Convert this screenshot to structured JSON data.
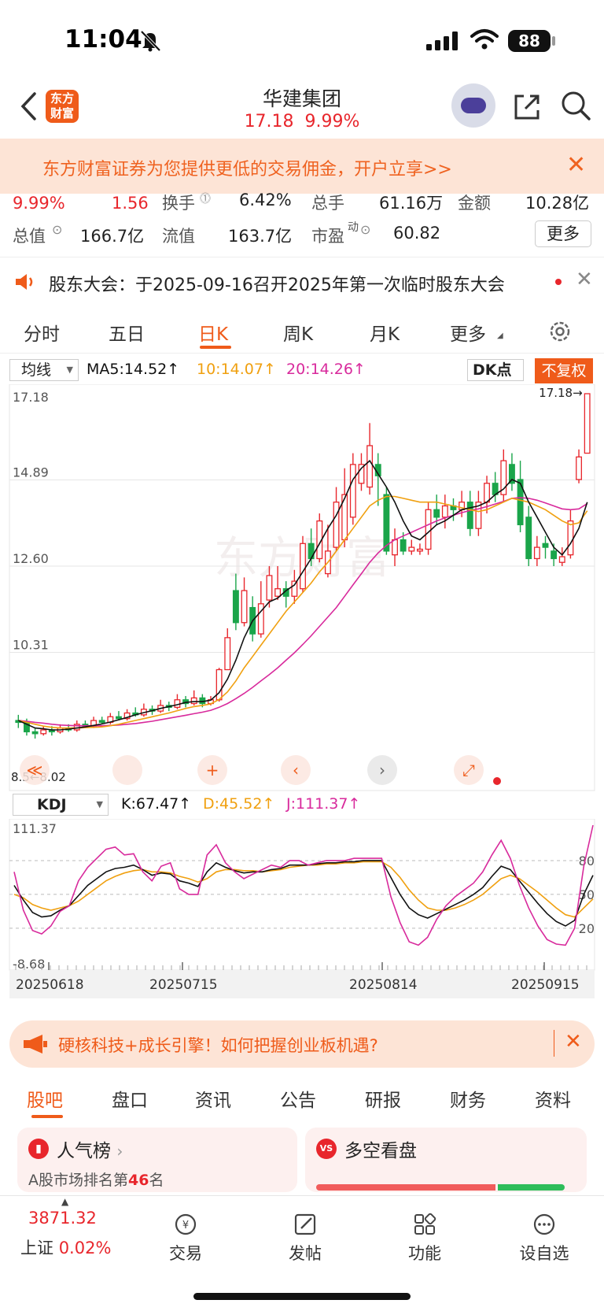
{
  "status_bar": {
    "time": "11:04",
    "battery": "88"
  },
  "nav": {
    "logo": "东方财富",
    "title": "华建集团",
    "price": "17.18",
    "change_pct": "9.99%"
  },
  "promo": {
    "text": "东方财富证券为您提供更低的交易佣金，开户立享>>"
  },
  "stats": {
    "row1": [
      {
        "value": "9.99%"
      },
      {
        "value": "1.56"
      },
      {
        "label": "换手",
        "value": "6.42%"
      },
      {
        "label": "总手",
        "value": "61.16万"
      },
      {
        "label": "金额",
        "value": "10.28亿"
      }
    ],
    "row2": [
      {
        "label": "总值",
        "value": "166.7亿"
      },
      {
        "label": "流值",
        "value": "163.7亿"
      },
      {
        "label": "市盈",
        "label_sup": "动",
        "value": "60.82"
      }
    ],
    "more": "更多"
  },
  "notice": {
    "text": "股东大会：于2025-09-16召开2025年第一次临时股东大会"
  },
  "period_tabs": [
    "分时",
    "五日",
    "日K",
    "周K",
    "月K",
    "更多"
  ],
  "ma_row": {
    "selector": "均线",
    "ma5": "MA5:14.52",
    "ma10": "10:14.07",
    "ma20": "20:14.26",
    "dk": "DK点",
    "fuquan": "不复权"
  },
  "kdj_row": {
    "selector": "KDJ",
    "k": "K:67.47",
    "d": "D:45.52",
    "j": "J:111.37"
  },
  "colors": {
    "up": "#e8262c",
    "down": "#1aa54a",
    "ma5": "#111111",
    "ma10": "#f0a010",
    "ma20": "#d82a9c",
    "accent": "#ef5b1a"
  },
  "chart_data": [
    {
      "type": "candlestick",
      "y_ticks": [
        "17.18",
        "14.89",
        "12.60",
        "10.31",
        "8.02"
      ],
      "ylim": [
        8.02,
        17.18
      ],
      "high_label": "17.18",
      "low_label": "8.02",
      "left_label": "8.5",
      "watermark": "东方财富",
      "candles": [
        [
          8.5,
          8.45,
          8.65,
          8.3
        ],
        [
          8.45,
          8.2,
          8.55,
          8.1
        ],
        [
          8.2,
          8.15,
          8.3,
          8.02
        ],
        [
          8.15,
          8.25,
          8.35,
          8.1
        ],
        [
          8.25,
          8.2,
          8.35,
          8.1
        ],
        [
          8.2,
          8.3,
          8.4,
          8.15
        ],
        [
          8.3,
          8.25,
          8.4,
          8.2
        ],
        [
          8.25,
          8.4,
          8.5,
          8.2
        ],
        [
          8.4,
          8.35,
          8.5,
          8.3
        ],
        [
          8.35,
          8.5,
          8.6,
          8.3
        ],
        [
          8.5,
          8.45,
          8.6,
          8.4
        ],
        [
          8.45,
          8.6,
          8.7,
          8.4
        ],
        [
          8.6,
          8.55,
          8.75,
          8.5
        ],
        [
          8.55,
          8.7,
          8.8,
          8.5
        ],
        [
          8.7,
          8.65,
          8.85,
          8.6
        ],
        [
          8.65,
          8.8,
          8.95,
          8.6
        ],
        [
          8.8,
          8.75,
          8.9,
          8.65
        ],
        [
          8.75,
          8.9,
          9.05,
          8.7
        ],
        [
          8.9,
          8.85,
          9.0,
          8.75
        ],
        [
          8.85,
          9.05,
          9.2,
          8.8
        ],
        [
          9.05,
          8.95,
          9.15,
          8.85
        ],
        [
          8.95,
          9.1,
          9.3,
          8.9
        ],
        [
          9.1,
          8.95,
          9.2,
          8.85
        ],
        [
          8.95,
          9.05,
          9.15,
          8.9
        ],
        [
          9.05,
          9.85,
          9.9,
          9.0
        ],
        [
          9.85,
          10.7,
          10.95,
          10.5
        ],
        [
          11.95,
          11.1,
          12.4,
          10.9
        ],
        [
          11.1,
          11.95,
          12.3,
          11.0
        ],
        [
          11.5,
          10.8,
          11.8,
          10.6
        ],
        [
          10.8,
          11.6,
          12.2,
          10.7
        ],
        [
          11.7,
          12.35,
          12.6,
          11.5
        ],
        [
          11.8,
          12.0,
          12.6,
          11.7
        ],
        [
          12.0,
          11.8,
          12.2,
          11.5
        ],
        [
          11.8,
          12.2,
          12.5,
          11.6
        ],
        [
          12.0,
          13.2,
          13.4,
          11.9
        ],
        [
          13.2,
          12.8,
          13.6,
          12.6
        ],
        [
          12.8,
          13.8,
          14.0,
          12.7
        ],
        [
          12.4,
          13.0,
          13.7,
          12.3
        ],
        [
          13.1,
          14.3,
          14.7,
          13.0
        ],
        [
          13.3,
          14.5,
          15.2,
          13.1
        ],
        [
          13.9,
          15.3,
          15.6,
          13.7
        ],
        [
          14.8,
          15.3,
          15.6,
          14.6
        ],
        [
          14.7,
          15.8,
          16.4,
          14.5
        ],
        [
          15.3,
          15.0,
          15.6,
          14.2
        ],
        [
          14.5,
          13.0,
          14.7,
          12.9
        ],
        [
          12.9,
          13.3,
          13.6,
          12.6
        ],
        [
          13.3,
          13.0,
          13.5,
          12.9
        ],
        [
          13.0,
          13.1,
          13.3,
          12.9
        ],
        [
          13.0,
          13.05,
          13.2,
          12.9
        ],
        [
          13.05,
          14.1,
          14.3,
          12.9
        ],
        [
          14.1,
          13.9,
          14.5,
          13.7
        ],
        [
          13.9,
          14.2,
          14.5,
          13.6
        ],
        [
          14.2,
          14.1,
          14.4,
          13.8
        ],
        [
          14.1,
          14.3,
          14.6,
          13.9
        ],
        [
          14.3,
          13.6,
          14.6,
          13.4
        ],
        [
          13.6,
          14.3,
          14.6,
          13.4
        ],
        [
          14.3,
          14.8,
          15.0,
          14.0
        ],
        [
          14.8,
          14.5,
          15.1,
          14.3
        ],
        [
          14.5,
          15.4,
          15.7,
          14.3
        ],
        [
          15.3,
          14.8,
          15.6,
          14.6
        ],
        [
          14.9,
          13.7,
          15.4,
          13.5
        ],
        [
          13.9,
          12.8,
          14.2,
          12.6
        ],
        [
          12.8,
          13.1,
          13.4,
          12.6
        ],
        [
          13.2,
          13.1,
          13.4,
          12.8
        ],
        [
          13.0,
          12.8,
          13.2,
          12.6
        ],
        [
          12.7,
          12.85,
          13.1,
          12.6
        ],
        [
          12.9,
          13.8,
          14.1,
          12.8
        ],
        [
          14.9,
          15.5,
          15.7,
          14.8
        ],
        [
          15.6,
          17.18,
          17.18,
          15.6
        ]
      ],
      "ma5": [
        8.5,
        8.4,
        8.3,
        8.28,
        8.25,
        8.25,
        8.27,
        8.3,
        8.33,
        8.37,
        8.41,
        8.46,
        8.52,
        8.58,
        8.65,
        8.71,
        8.76,
        8.82,
        8.87,
        8.92,
        8.98,
        9.0,
        9.0,
        9.04,
        9.24,
        9.6,
        10.1,
        10.7,
        11.15,
        11.4,
        11.65,
        11.75,
        11.95,
        12.1,
        12.45,
        12.8,
        13.2,
        13.6,
        13.95,
        14.4,
        14.9,
        15.2,
        15.4,
        15.05,
        14.7,
        14.3,
        13.8,
        13.4,
        13.3,
        13.5,
        13.7,
        13.8,
        13.95,
        14.1,
        14.15,
        14.2,
        14.3,
        14.5,
        14.65,
        14.9,
        14.8,
        14.3,
        13.9,
        13.5,
        13.1,
        12.9,
        13.2,
        13.6,
        14.3
      ],
      "ma10": [
        8.5,
        8.45,
        8.4,
        8.35,
        8.32,
        8.3,
        8.3,
        8.3,
        8.31,
        8.32,
        8.33,
        8.36,
        8.4,
        8.45,
        8.5,
        8.55,
        8.6,
        8.65,
        8.7,
        8.76,
        8.82,
        8.87,
        8.9,
        8.94,
        9.06,
        9.26,
        9.55,
        9.9,
        10.2,
        10.5,
        10.8,
        11.1,
        11.4,
        11.65,
        11.9,
        12.15,
        12.45,
        12.7,
        13.0,
        13.3,
        13.6,
        13.9,
        14.2,
        14.35,
        14.45,
        14.45,
        14.4,
        14.35,
        14.3,
        14.3,
        14.3,
        14.25,
        14.2,
        14.15,
        14.1,
        14.05,
        14.1,
        14.2,
        14.3,
        14.4,
        14.35,
        14.3,
        14.2,
        14.1,
        13.95,
        13.8,
        13.7,
        13.75,
        14.07
      ],
      "ma20": [
        8.5,
        8.48,
        8.45,
        8.43,
        8.4,
        8.38,
        8.37,
        8.36,
        8.36,
        8.36,
        8.36,
        8.37,
        8.38,
        8.4,
        8.42,
        8.45,
        8.48,
        8.52,
        8.56,
        8.6,
        8.64,
        8.68,
        8.72,
        8.77,
        8.85,
        8.95,
        9.08,
        9.22,
        9.38,
        9.55,
        9.72,
        9.9,
        10.1,
        10.3,
        10.52,
        10.75,
        11.0,
        11.25,
        11.5,
        11.8,
        12.1,
        12.4,
        12.7,
        12.95,
        13.15,
        13.3,
        13.4,
        13.5,
        13.6,
        13.7,
        13.8,
        13.88,
        13.95,
        14.02,
        14.08,
        14.12,
        14.18,
        14.25,
        14.32,
        14.4,
        14.42,
        14.4,
        14.35,
        14.28,
        14.2,
        14.12,
        14.1,
        14.12,
        14.26
      ]
    },
    {
      "type": "line",
      "indicator": "KDJ",
      "ylim": [
        -8.68,
        111.37
      ],
      "y_ticks_left": [
        "111.37",
        "-8.68"
      ],
      "y_ticks_right": [
        "80",
        "50",
        "20"
      ],
      "x_labels": [
        "20250618",
        "20250715",
        "20250814",
        "20250915"
      ],
      "k": [
        58,
        45,
        34,
        30,
        31,
        36,
        40,
        49,
        58,
        64,
        70,
        73,
        74,
        76,
        72,
        67,
        69,
        68,
        62,
        60,
        57,
        70,
        78,
        74,
        71,
        69,
        70,
        70,
        72,
        73,
        76,
        76,
        76,
        77,
        78,
        78,
        79,
        79,
        80,
        80,
        80,
        65,
        50,
        38,
        32,
        29,
        33,
        37,
        41,
        45,
        50,
        56,
        66,
        75,
        72,
        62,
        52,
        42,
        33,
        26,
        22,
        27,
        50,
        67
      ],
      "d": [
        50,
        47,
        41,
        38,
        36,
        38,
        40,
        44,
        50,
        56,
        62,
        66,
        69,
        71,
        72,
        70,
        70,
        69,
        66,
        64,
        61,
        64,
        70,
        72,
        72,
        71,
        71,
        70,
        71,
        72,
        74,
        75,
        76,
        76,
        77,
        77,
        78,
        78,
        79,
        79,
        79,
        74,
        65,
        54,
        45,
        38,
        36,
        36,
        38,
        41,
        45,
        50,
        57,
        64,
        67,
        64,
        58,
        52,
        45,
        38,
        32,
        30,
        38,
        46
      ],
      "j": [
        70,
        36,
        18,
        15,
        22,
        35,
        40,
        62,
        74,
        82,
        90,
        92,
        85,
        86,
        70,
        62,
        75,
        78,
        55,
        50,
        50,
        85,
        94,
        78,
        70,
        64,
        68,
        72,
        76,
        74,
        80,
        80,
        76,
        78,
        80,
        80,
        80,
        82,
        82,
        82,
        82,
        48,
        25,
        8,
        5,
        12,
        28,
        40,
        48,
        54,
        60,
        70,
        85,
        98,
        82,
        58,
        38,
        22,
        10,
        6,
        5,
        20,
        75,
        111.37
      ]
    }
  ],
  "promo2": {
    "text": "硬核科技+成长引擎！如何把握创业板机遇?"
  },
  "bottom_tabs": [
    "股吧",
    "盘口",
    "资讯",
    "公告",
    "研报",
    "财务",
    "资料"
  ],
  "cards": {
    "left": {
      "title": "人气榜",
      "subtitle_prefix": "A股市场排名第",
      "rank": "46",
      "subtitle_suffix": "名"
    },
    "right": {
      "badge": "VS",
      "title": "多空看盘",
      "bull_ratio": 0.72
    }
  },
  "toolbar": {
    "index_value": "3871.32",
    "index_name": "上证",
    "index_change": "0.02%",
    "items": [
      "交易",
      "发帖",
      "功能",
      "设自选"
    ]
  }
}
